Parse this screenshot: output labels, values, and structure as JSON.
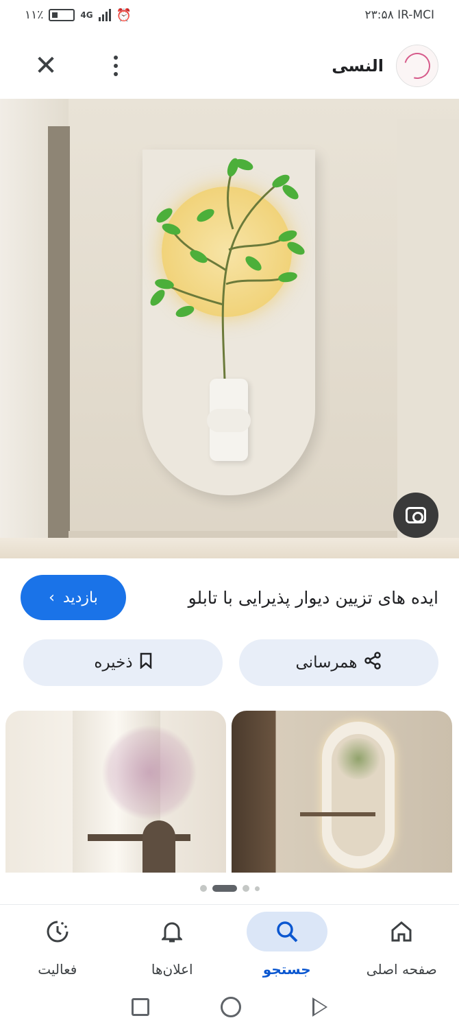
{
  "status_bar": {
    "battery": "۱۱٪",
    "network": "4G",
    "time_carrier": "۲۳:۵۸ IR-MCI"
  },
  "header": {
    "site_name": "النسی",
    "close_icon": "close-icon",
    "more_icon": "more-vert-icon"
  },
  "image": {
    "lens_icon": "lens-icon"
  },
  "result": {
    "title": "ایده های تزیین دیوار پذیرایی با تابلو",
    "visit_label": "بازدید",
    "visit_chevron": "‹"
  },
  "actions": {
    "share_label": "همرسانی",
    "save_label": "ذخیره"
  },
  "bottom_nav": {
    "items": [
      {
        "label": "فعالیت",
        "icon": "activity-icon"
      },
      {
        "label": "اعلان‌ها",
        "icon": "bell-icon"
      },
      {
        "label": "جستجو",
        "icon": "search-icon"
      },
      {
        "label": "صفحه اصلی",
        "icon": "home-icon"
      }
    ]
  },
  "colors": {
    "accent": "#1a73e8",
    "active_nav": "#0b57d0",
    "action_bg": "#e8eef8"
  }
}
